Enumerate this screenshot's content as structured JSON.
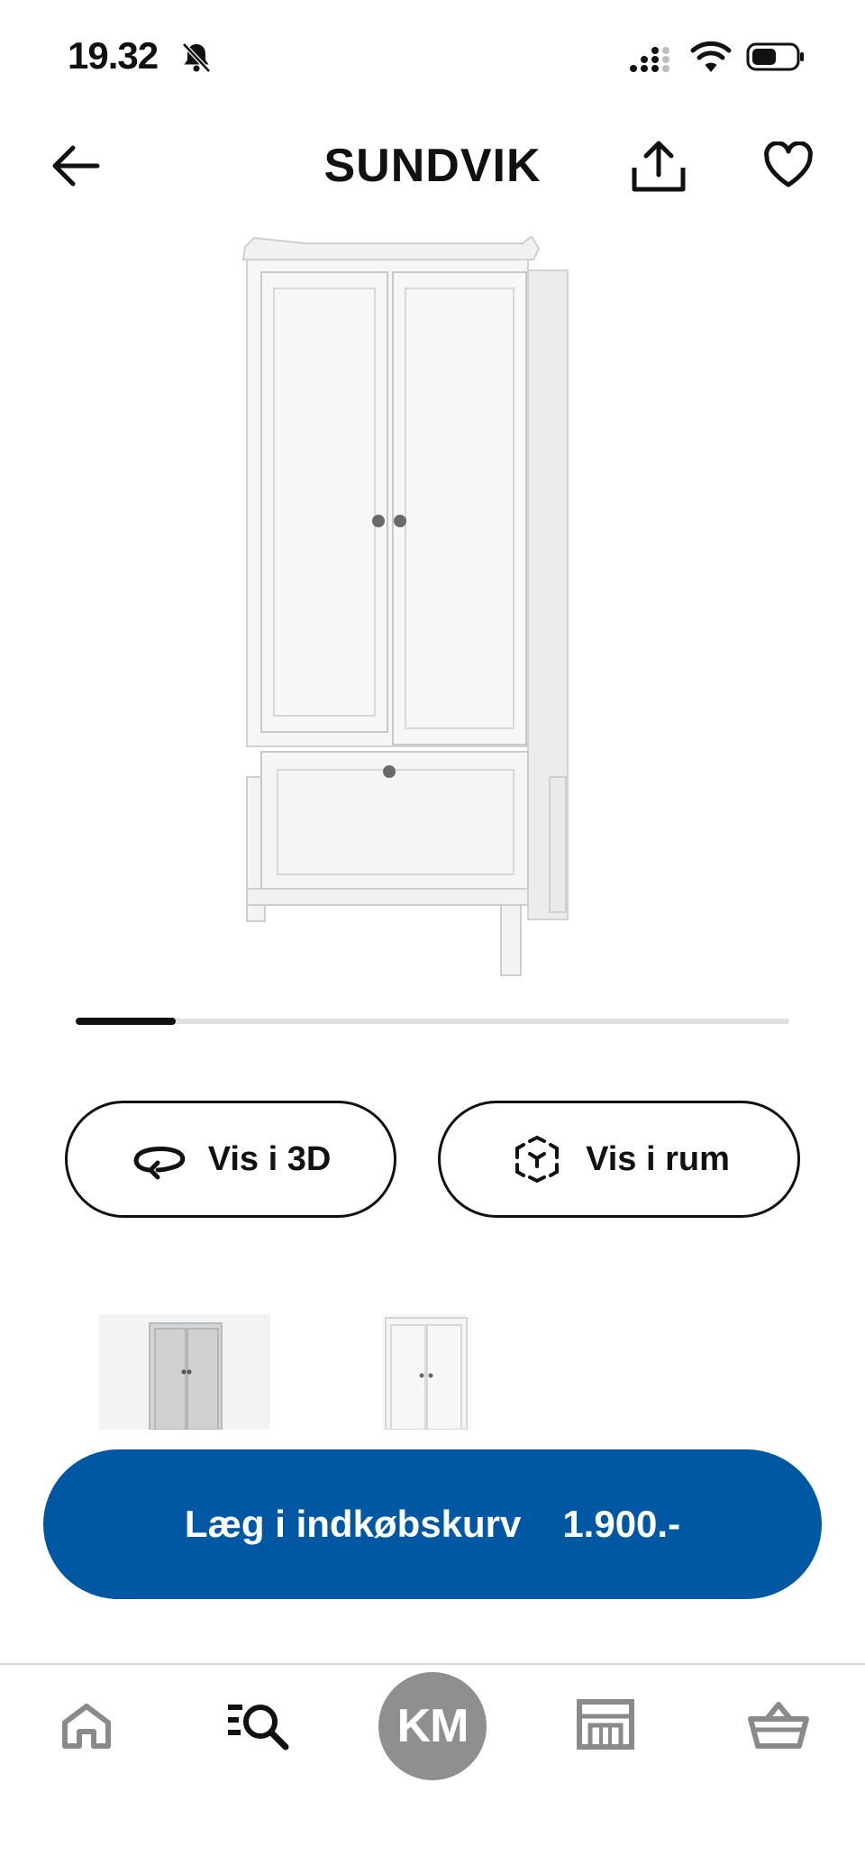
{
  "status_bar": {
    "time": "19.32",
    "icons": [
      "bell-muted-icon",
      "cellular-signal-icon",
      "wifi-icon",
      "battery-icon"
    ]
  },
  "header": {
    "title": "SUNDVIK",
    "back_icon": "arrow-left-icon",
    "share_icon": "share-icon",
    "favorite_icon": "heart-icon"
  },
  "carousel": {
    "progress": 0.14
  },
  "actions": {
    "view_3d_label": "Vis i 3D",
    "view_3d_icon": "rotate-3d-icon",
    "view_room_label": "Vis i rum",
    "view_room_icon": "ar-cube-icon"
  },
  "variants": [
    {
      "color": "grey",
      "selected": false
    },
    {
      "color": "white",
      "selected": true
    }
  ],
  "cart": {
    "label": "Læg i indkøbskurv",
    "price": "1.900.-",
    "color": "#0058a3"
  },
  "nav": {
    "items": [
      "home-icon",
      "search-icon",
      "account-avatar",
      "store-icon",
      "basket-icon"
    ],
    "avatar_initials": "KM",
    "avatar_color": "#8f8f8f"
  }
}
